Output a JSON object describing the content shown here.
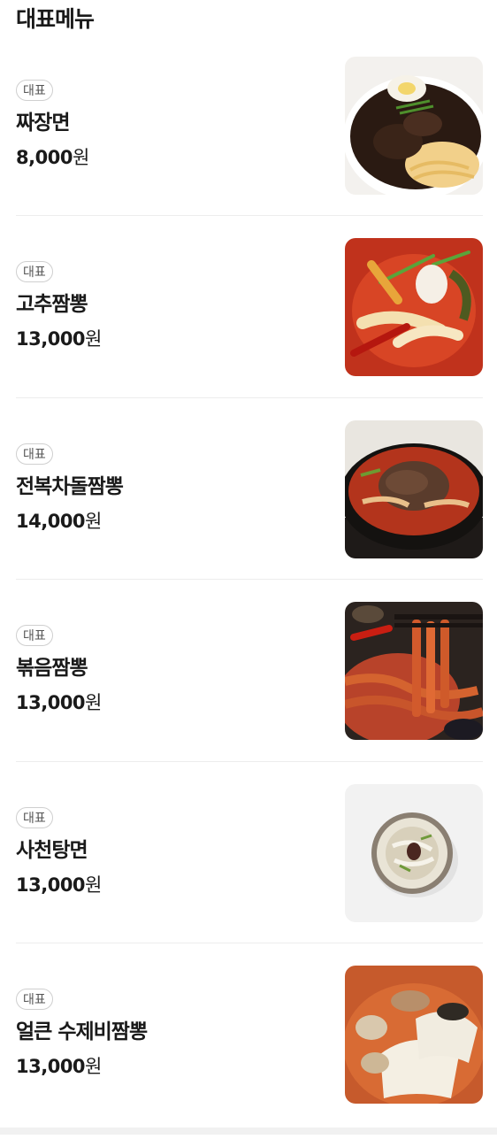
{
  "section": {
    "title": "대표메뉴"
  },
  "menu": [
    {
      "badge": "대표",
      "name": "짜장면",
      "price_num": "8,000",
      "price_unit": "원",
      "image": "jajangmyeon-photo"
    },
    {
      "badge": "대표",
      "name": "고추짬뽕",
      "price_num": "13,000",
      "price_unit": "원",
      "image": "pepper-jjamppong-photo"
    },
    {
      "badge": "대표",
      "name": "전복차돌짬뽕",
      "price_num": "14,000",
      "price_unit": "원",
      "image": "abalone-brisket-jjamppong-photo"
    },
    {
      "badge": "대표",
      "name": "볶음짬뽕",
      "price_num": "13,000",
      "price_unit": "원",
      "image": "stirfried-jjamppong-photo"
    },
    {
      "badge": "대표",
      "name": "사천탕면",
      "price_num": "13,000",
      "price_unit": "원",
      "image": "sichuan-tangmyeon-photo"
    },
    {
      "badge": "대표",
      "name": "얼큰 수제비짬뽕",
      "price_num": "13,000",
      "price_unit": "원",
      "image": "sujebi-jjamppong-photo"
    }
  ]
}
